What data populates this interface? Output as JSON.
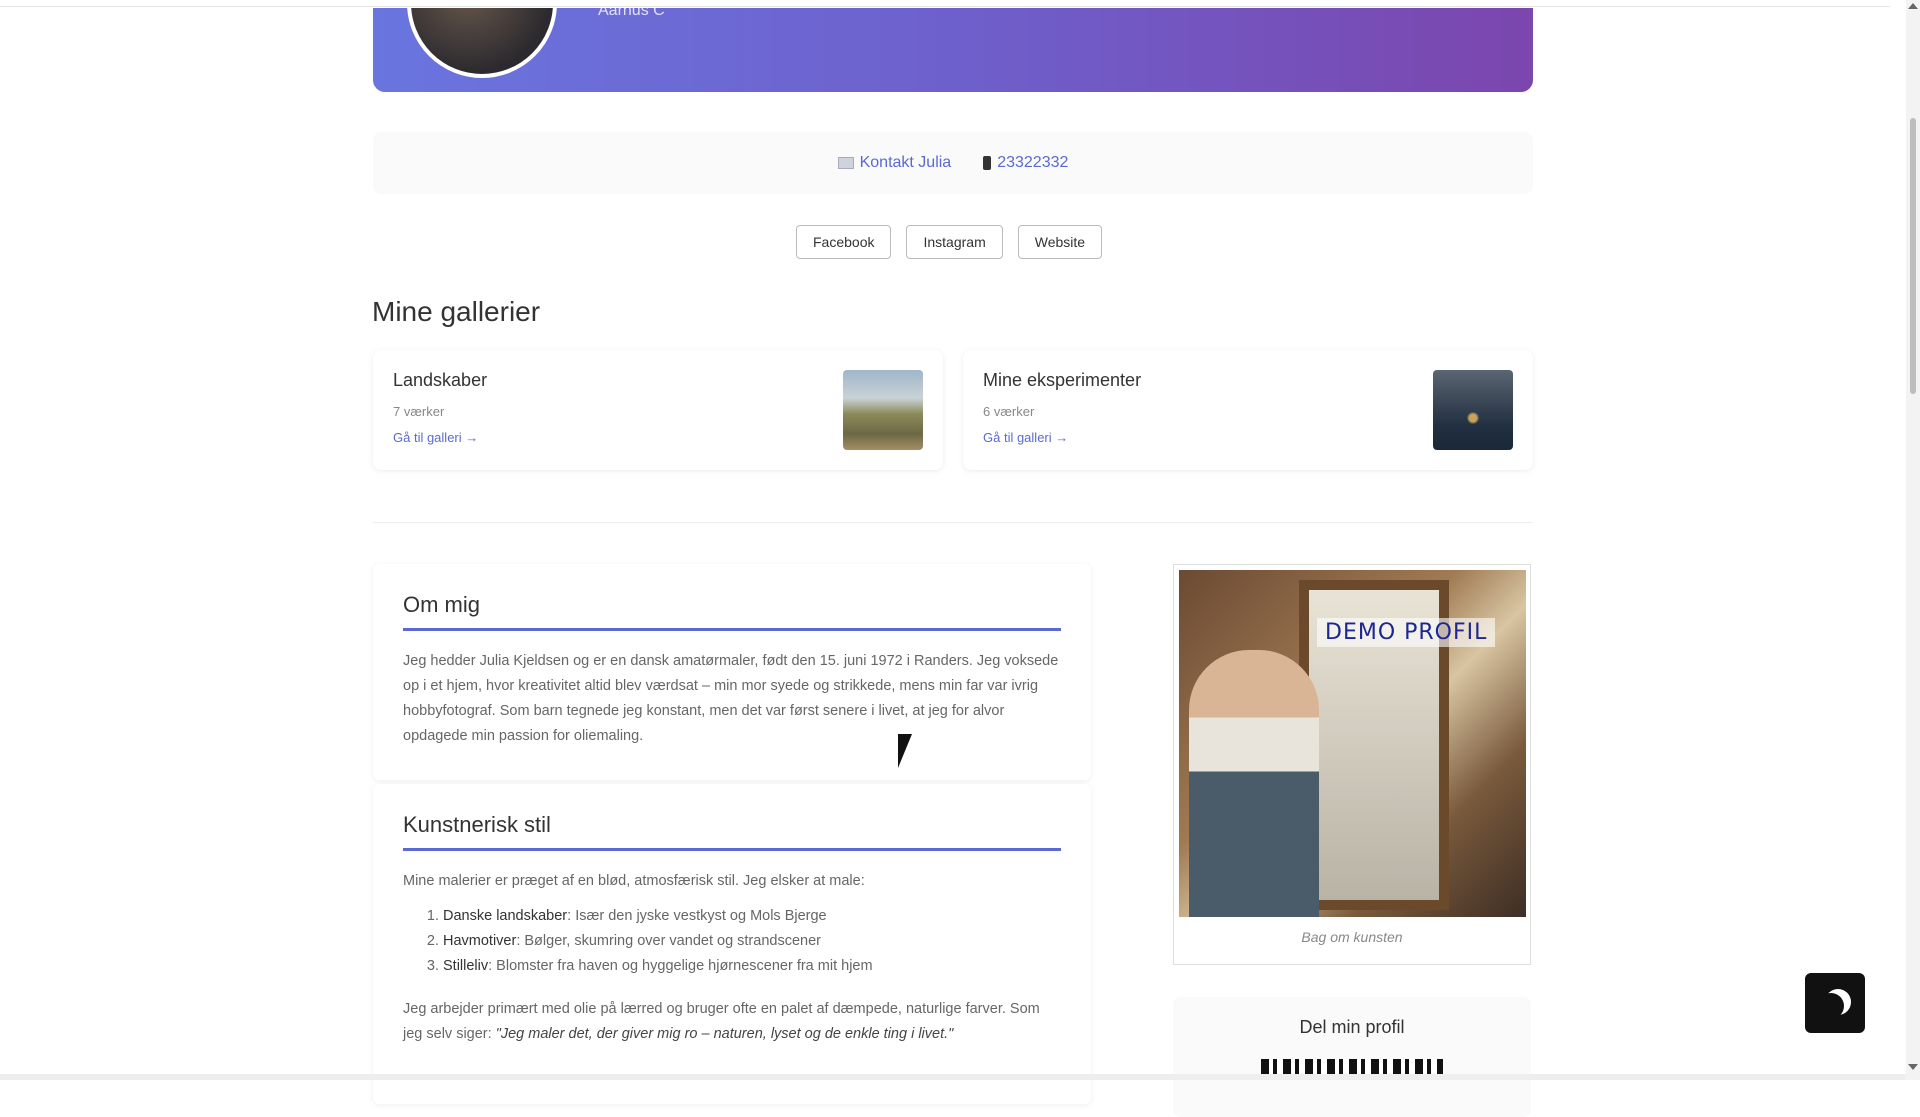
{
  "header": {
    "location": "Aarhus C"
  },
  "contact": {
    "contact_label": "Kontakt Julia",
    "phone": "23322332"
  },
  "social": [
    "Facebook",
    "Instagram",
    "Website"
  ],
  "galleries_title": "Mine gallerier",
  "galleries": [
    {
      "title": "Landskaber",
      "count": "7 værker",
      "link": "Gå til galleri →"
    },
    {
      "title": "Mine eksperimenter",
      "count": "6 værker",
      "link": "Gå til galleri →"
    }
  ],
  "about": {
    "title": "Om mig",
    "text": "Jeg hedder Julia Kjeldsen og er en dansk amatørmaler, født den 15. juni 1972 i Randers. Jeg voksede op i et hjem, hvor kreativitet altid blev værdsat – min mor syede og strikkede, mens min far var ivrig hobbyfotograf. Som barn tegnede jeg konstant, men det var først senere i livet, at jeg for alvor opdagede min passion for oliemaling."
  },
  "style": {
    "title": "Kunstnerisk stil",
    "intro": "Mine malerier er præget af en blød, atmosfærisk stil. Jeg elsker at male:",
    "items": [
      {
        "name": "Danske landskaber",
        "desc": ": Især den jyske vestkyst og Mols Bjerge"
      },
      {
        "name": "Havmotiver",
        "desc": ": Bølger, skumring over vandet og strandscener"
      },
      {
        "name": "Stilleliv",
        "desc": ": Blomster fra haven og hyggelige hjørnescener fra mit hjem"
      }
    ],
    "outro": "Jeg arbejder primært med olie på lærred og bruger ofte en palet af dæmpede, naturlige farver. Som jeg selv siger: ",
    "quote": "\"Jeg maler det, der giver mig ro – naturen, lyset og de enkle ting i livet.\""
  },
  "sidebar": {
    "photo_label": "DEMO PROFIL",
    "caption": "Bag om kunsten",
    "share_title": "Del min profil"
  },
  "colors": {
    "accent": "#5b6ad0",
    "banner_start": "#6a75df",
    "banner_end": "#7b46ad"
  },
  "icons": {
    "dark_mode": "moon-icon",
    "mail": "mail-icon",
    "phone": "phone-icon"
  }
}
